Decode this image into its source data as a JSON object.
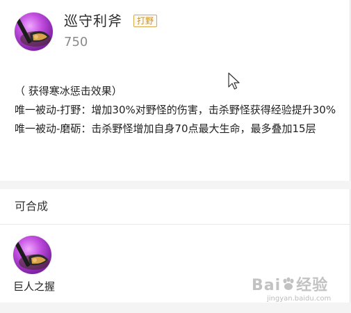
{
  "item": {
    "name": "巡守利斧",
    "tag": "打野",
    "price": "750",
    "icon": "axe-item-icon",
    "description": [
      "（ 获得寒冰惩击效果）",
      "唯一被动-打野：增加30%对野怪的伤害，击杀野怪获得经验提升30%",
      "唯一被动-磨砺：击杀野怪增加自身70点最大生命，最多叠加15层"
    ]
  },
  "combine": {
    "title": "可合成",
    "items": [
      {
        "name": "巨人之握",
        "icon": "giant-grip-item-icon"
      }
    ]
  },
  "watermark": {
    "brand": "Bai",
    "brand_suffix": "经验",
    "url": "jingyan.baidu.com"
  },
  "colors": {
    "tag_border": "#d8a850",
    "tag_text": "#c8922e",
    "price_text": "#8a8a8a",
    "icon_purple": "#c24ee0"
  }
}
